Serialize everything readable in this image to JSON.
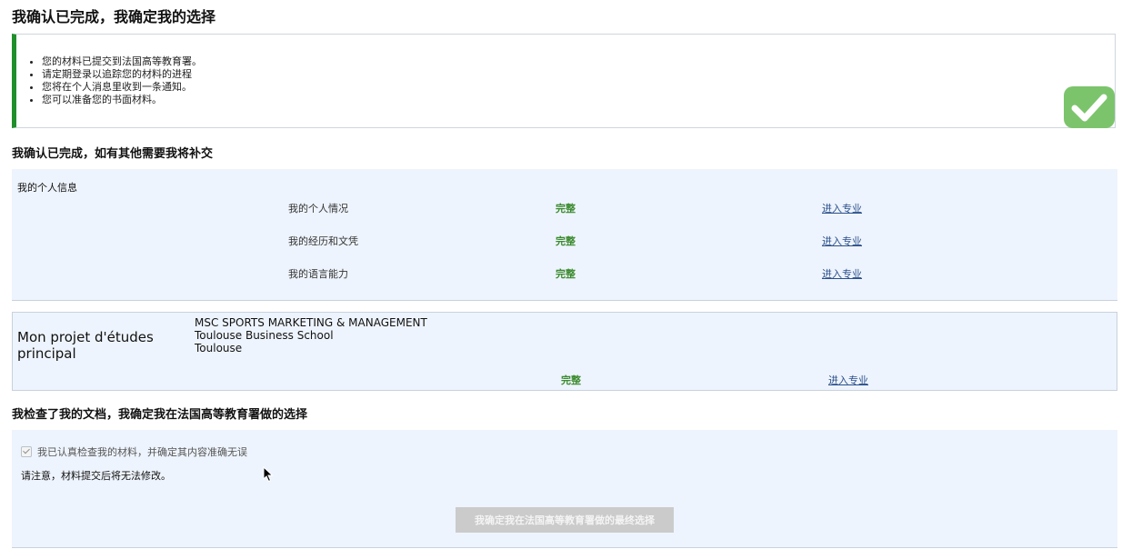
{
  "header": {
    "title": "我确认已完成，我确定我的选择"
  },
  "confirmation": {
    "items": [
      "您的材料已提交到法国高等教育署。",
      "请定期登录以追踪您的材料的进程",
      "您将在个人消息里收到一条通知。",
      "您可以准备您的书面材料。"
    ],
    "badge_icon": "check-icon",
    "accent_color": "#1f8f2b",
    "badge_color": "#7cc46c"
  },
  "completion": {
    "heading": "我确认已完成，如有其他需要我将补交",
    "personal": {
      "title": "我的个人信息",
      "rows": [
        {
          "label": "我的个人情况",
          "status": "完整",
          "link": "进入专业"
        },
        {
          "label": "我的经历和文凭",
          "status": "完整",
          "link": "进入专业"
        },
        {
          "label": "我的语言能力",
          "status": "完整",
          "link": "进入专业"
        }
      ]
    },
    "project": {
      "title": "Mon projet d'études principal",
      "program": "MSC SPORTS MARKETING & MANAGEMENT",
      "school": "Toulouse Business School",
      "city": "Toulouse",
      "status": "完整",
      "link": "进入专业"
    }
  },
  "final": {
    "heading": "我检查了我的文档，我确定我在法国高等教育署做的选择",
    "checkbox_label": "我已认真检查我的材料，并确定其内容准确无误",
    "checkbox_checked": true,
    "notice": "请注意，材料提交后将无法修改。",
    "button_label": "我确定我在法国高等教育署做的最终选择",
    "button_enabled": false
  }
}
